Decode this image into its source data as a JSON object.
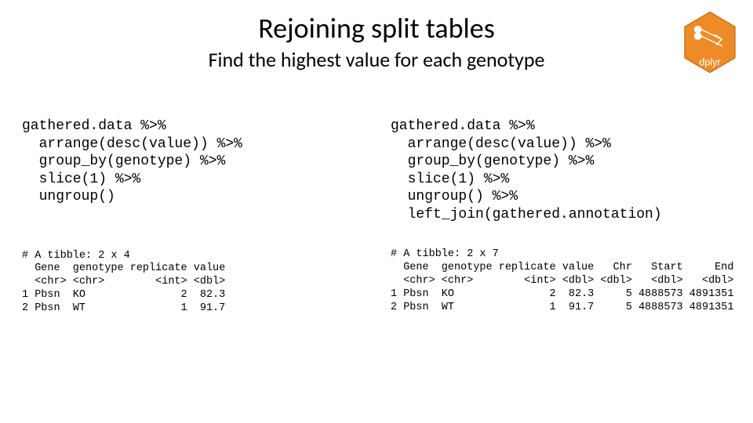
{
  "title": "Rejoining split tables",
  "subtitle": "Find the highest value for each genotype",
  "logo": {
    "label": "dplyr"
  },
  "left": {
    "code": "gathered.data %>%\n  arrange(desc(value)) %>%\n  group_by(genotype) %>%\n  slice(1) %>%\n  ungroup()",
    "output": "# A tibble: 2 x 4\n  Gene  genotype replicate value\n  <chr> <chr>        <int> <dbl>\n1 Pbsn  KO               2  82.3\n2 Pbsn  WT               1  91.7"
  },
  "right": {
    "code": "gathered.data %>%\n  arrange(desc(value)) %>%\n  group_by(genotype) %>%\n  slice(1) %>%\n  ungroup() %>%\n  left_join(gathered.annotation)",
    "output": "# A tibble: 2 x 7\n  Gene  genotype replicate value   Chr   Start     End\n  <chr> <chr>        <int> <dbl> <dbl>   <dbl>   <dbl>\n1 Pbsn  KO               2  82.3     5 4888573 4891351\n2 Pbsn  WT               1  91.7     5 4888573 4891351"
  }
}
